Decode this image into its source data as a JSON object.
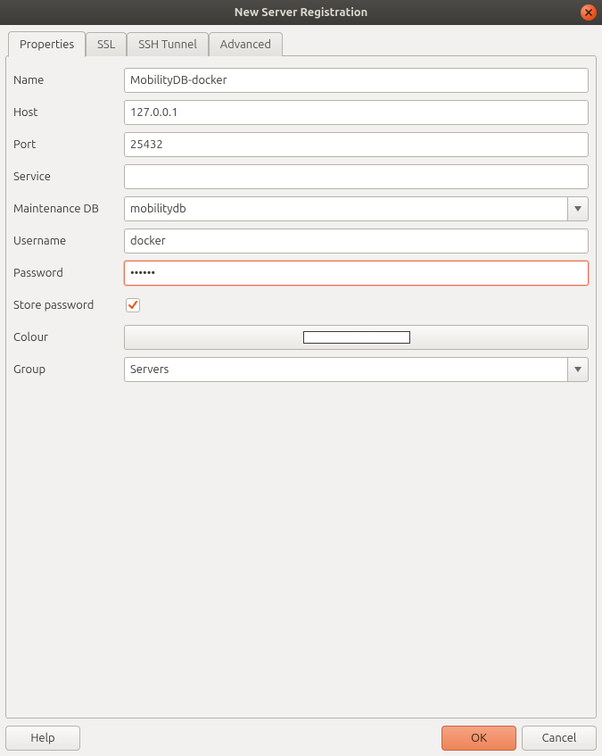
{
  "window": {
    "title": "New Server Registration"
  },
  "tabs": [
    {
      "label": "Properties",
      "active": true
    },
    {
      "label": "SSL",
      "active": false
    },
    {
      "label": "SSH Tunnel",
      "active": false
    },
    {
      "label": "Advanced",
      "active": false
    }
  ],
  "form": {
    "name": {
      "label": "Name",
      "value": "MobilityDB-docker"
    },
    "host": {
      "label": "Host",
      "value": "127.0.0.1"
    },
    "port": {
      "label": "Port",
      "value": "25432"
    },
    "service": {
      "label": "Service",
      "value": ""
    },
    "maintenance_db": {
      "label": "Maintenance DB",
      "value": "mobilitydb"
    },
    "username": {
      "label": "Username",
      "value": "docker"
    },
    "password": {
      "label": "Password",
      "value": "••••••"
    },
    "store_password": {
      "label": "Store password",
      "checked": true
    },
    "colour": {
      "label": "Colour",
      "value": "#ffffff"
    },
    "group": {
      "label": "Group",
      "value": "Servers"
    }
  },
  "buttons": {
    "help": "Help",
    "ok": "OK",
    "cancel": "Cancel"
  }
}
